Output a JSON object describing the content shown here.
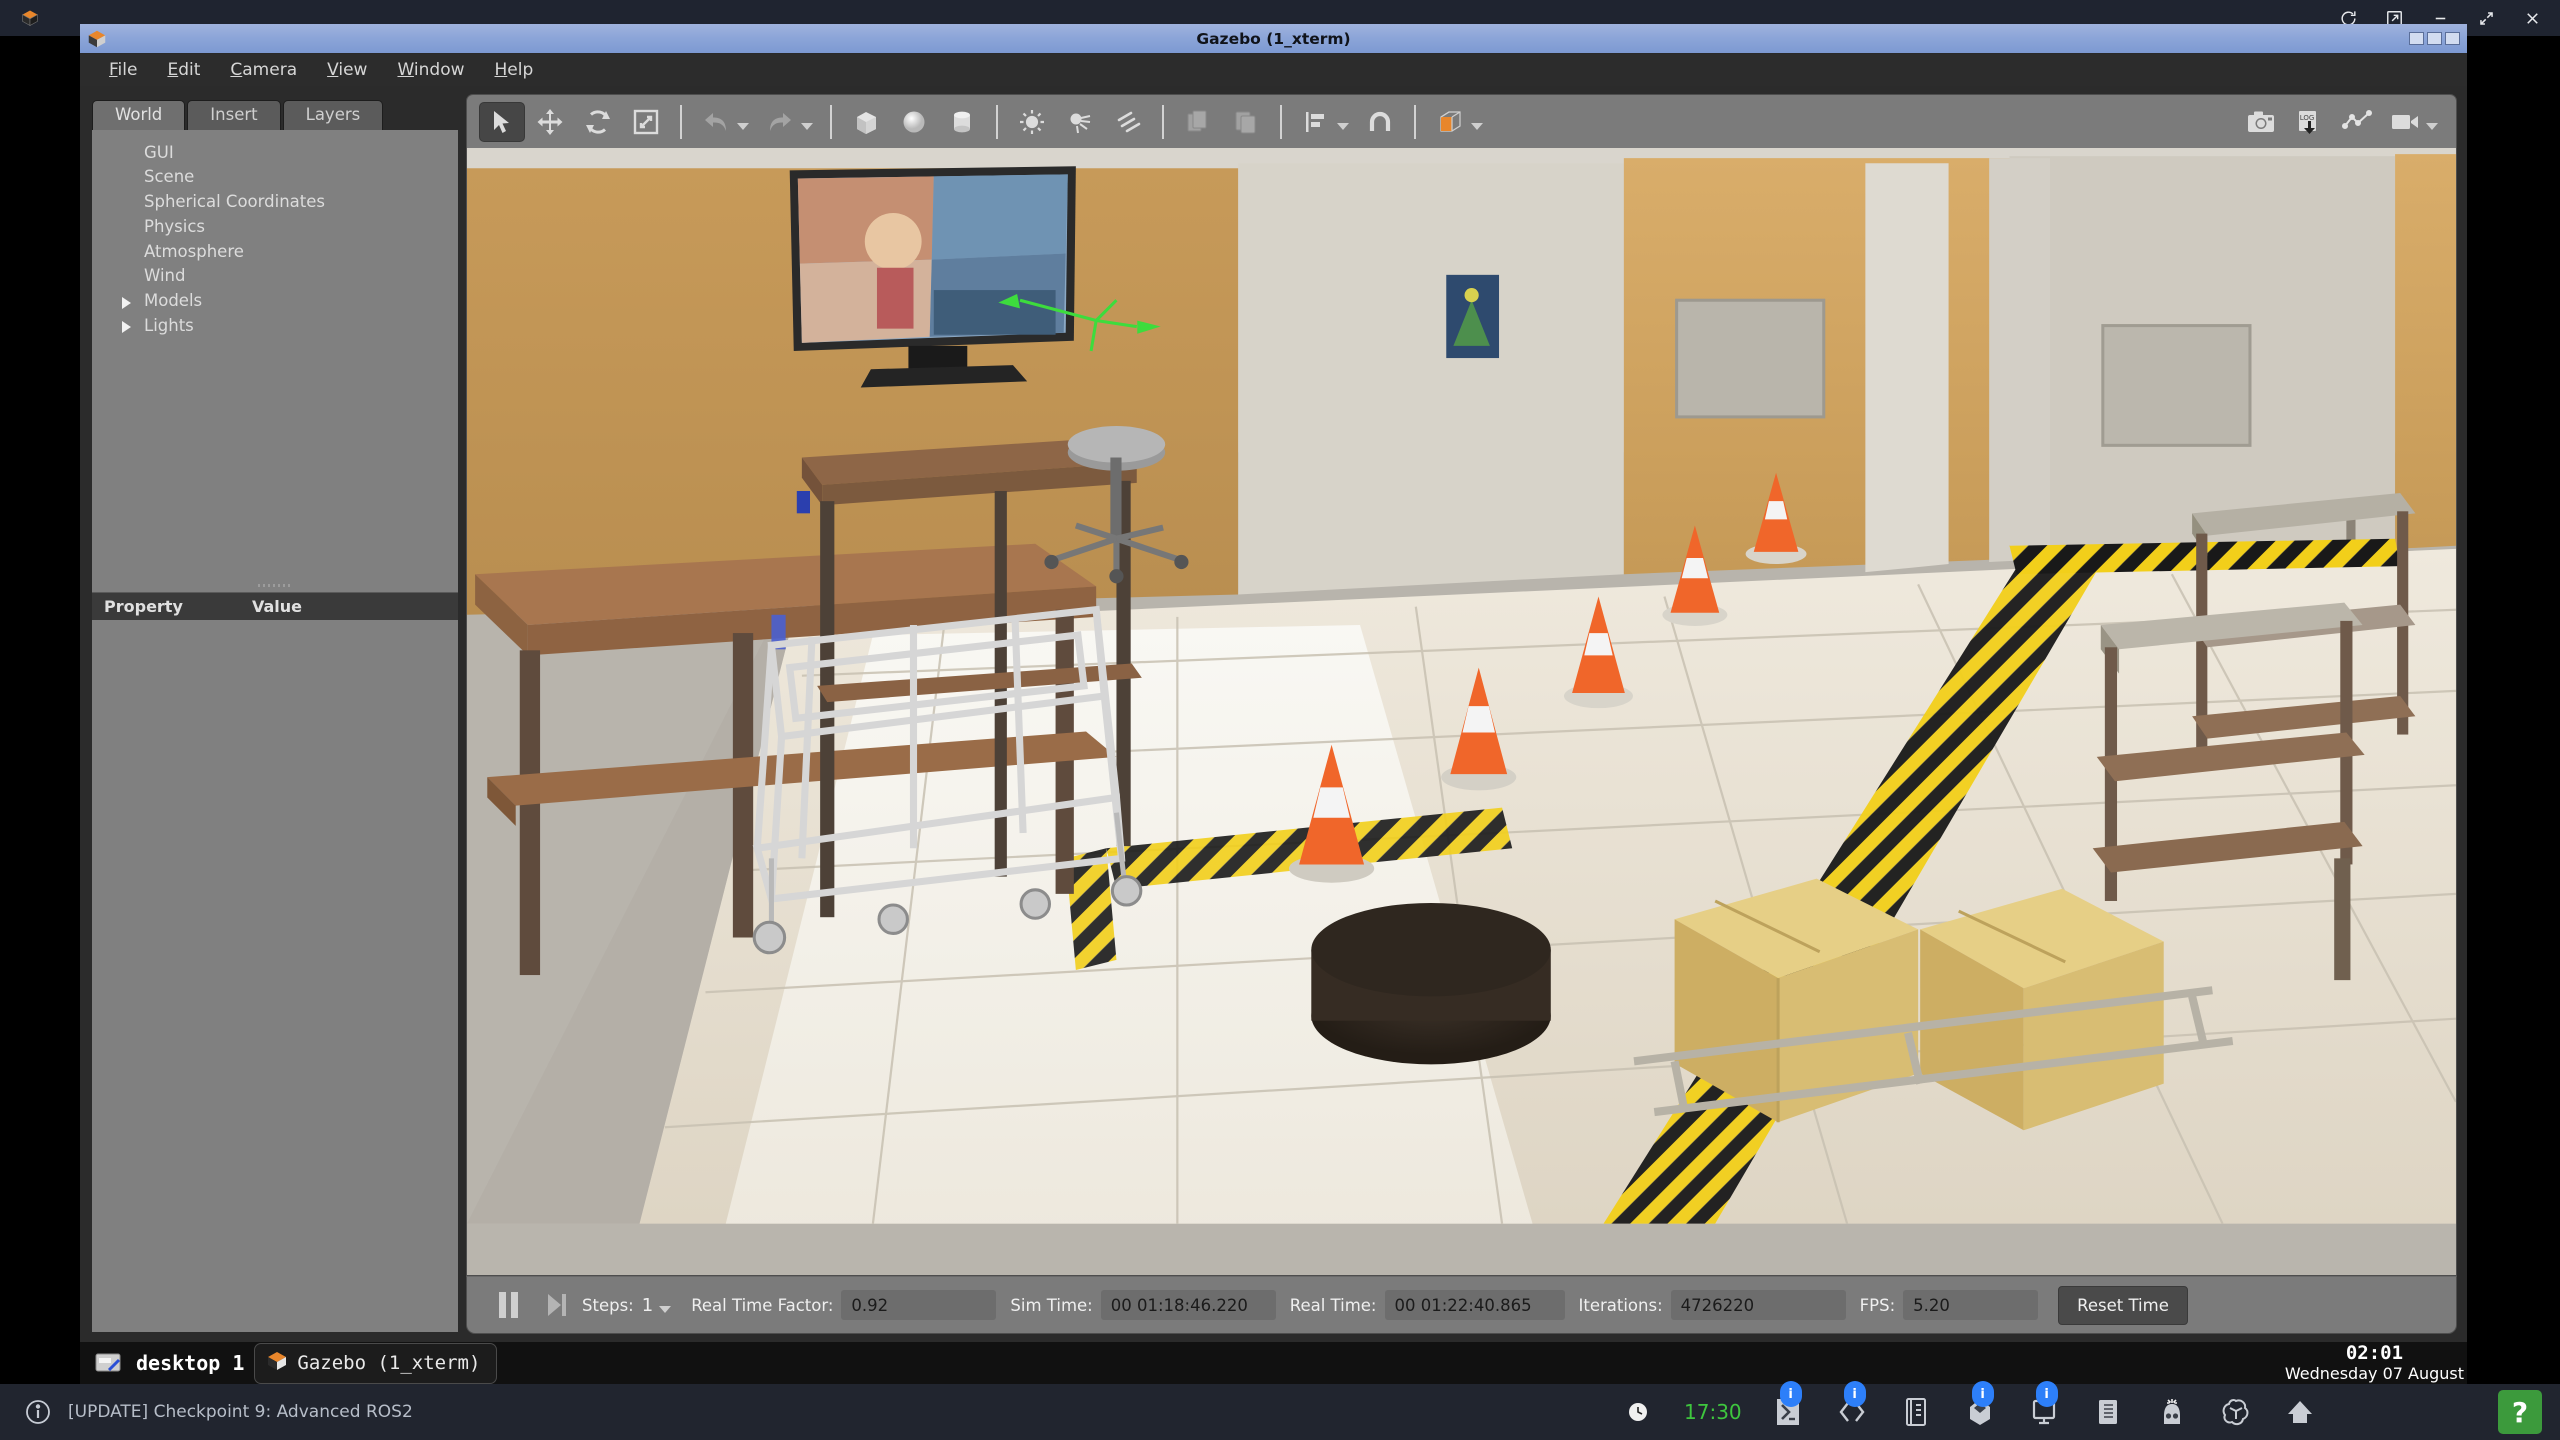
{
  "window": {
    "title": "Gazebo (1_xterm)",
    "icon": "gazebo-icon"
  },
  "top_chrome": {
    "app_icon": "gazebo-icon",
    "buttons": [
      {
        "name": "refresh-icon",
        "glyph": "⟳"
      },
      {
        "name": "external-link-icon",
        "glyph": "↗"
      },
      {
        "name": "minimize-icon",
        "glyph": "—"
      },
      {
        "name": "maximize-icon",
        "glyph": "⤡"
      },
      {
        "name": "close-icon",
        "glyph": "✕"
      }
    ]
  },
  "menubar": {
    "items": [
      {
        "label": "File",
        "mnemonic": "F"
      },
      {
        "label": "Edit",
        "mnemonic": "E"
      },
      {
        "label": "Camera",
        "mnemonic": "C"
      },
      {
        "label": "View",
        "mnemonic": "V"
      },
      {
        "label": "Window",
        "mnemonic": "W"
      },
      {
        "label": "Help",
        "mnemonic": "H"
      }
    ]
  },
  "left_panel": {
    "tabs": [
      {
        "label": "World",
        "active": true
      },
      {
        "label": "Insert",
        "active": false
      },
      {
        "label": "Layers",
        "active": false
      }
    ],
    "tree": [
      {
        "label": "GUI",
        "expandable": false
      },
      {
        "label": "Scene",
        "expandable": false
      },
      {
        "label": "Spherical Coordinates",
        "expandable": false
      },
      {
        "label": "Physics",
        "expandable": false
      },
      {
        "label": "Atmosphere",
        "expandable": false
      },
      {
        "label": "Wind",
        "expandable": false
      },
      {
        "label": "Models",
        "expandable": true
      },
      {
        "label": "Lights",
        "expandable": true
      }
    ],
    "property_table": {
      "columns": [
        "Property",
        "Value"
      ],
      "rows": []
    }
  },
  "toolbar": {
    "left_group": [
      {
        "name": "select-mode-icon",
        "active": true
      },
      {
        "name": "translate-mode-icon",
        "active": false
      },
      {
        "name": "rotate-mode-icon",
        "active": false
      },
      {
        "name": "scale-mode-icon",
        "active": false
      }
    ],
    "history_group": [
      {
        "name": "undo-icon",
        "disabled": true
      },
      {
        "name": "undo-dropdown-icon",
        "disabled": true
      },
      {
        "name": "redo-icon",
        "disabled": true
      },
      {
        "name": "redo-dropdown-icon",
        "disabled": true
      }
    ],
    "primitive_group": [
      {
        "name": "box-icon"
      },
      {
        "name": "sphere-icon"
      },
      {
        "name": "cylinder-icon"
      }
    ],
    "light_group": [
      {
        "name": "point-light-icon"
      },
      {
        "name": "spot-light-icon"
      },
      {
        "name": "directional-light-icon"
      }
    ],
    "clipboard_group": [
      {
        "name": "copy-icon",
        "disabled": true
      },
      {
        "name": "paste-icon",
        "disabled": true
      }
    ],
    "align_group": [
      {
        "name": "align-icon"
      },
      {
        "name": "snap-magnet-icon"
      }
    ],
    "view_group": [
      {
        "name": "view-angle-cube-icon",
        "accent": "#e8862b"
      }
    ],
    "right_group": [
      {
        "name": "screenshot-camera-icon"
      },
      {
        "name": "log-record-icon",
        "label": "LOG"
      },
      {
        "name": "plot-graph-icon"
      },
      {
        "name": "video-record-icon"
      }
    ]
  },
  "status_bar": {
    "pause_icon": "pause-icon",
    "step_icon": "step-forward-icon",
    "steps_label": "Steps:",
    "steps_value": "1",
    "real_time_factor_label": "Real Time Factor:",
    "real_time_factor_value": "0.92",
    "sim_time_label": "Sim Time:",
    "sim_time_value": "00 01:18:46.220",
    "real_time_label": "Real Time:",
    "real_time_value": "00 01:22:40.865",
    "iterations_label": "Iterations:",
    "iterations_value": "4726220",
    "fps_label": "FPS:",
    "fps_value": "5.20",
    "reset_button": "Reset Time"
  },
  "taskbar": {
    "desktop_icon": "desktop-icon",
    "desktop_label": "desktop 1",
    "task_icon": "gazebo-icon",
    "task_label": "Gazebo (1_xterm)",
    "clock_time": "02:01",
    "clock_date": "Wednesday 07 August"
  },
  "system_bar": {
    "info_icon": "info-icon",
    "notice": "[UPDATE] Checkpoint 9: Advanced ROS2",
    "clock_icon": "clock-icon",
    "clock_value": "17:30",
    "icons": [
      {
        "name": "terminal-icon",
        "badge": "i"
      },
      {
        "name": "code-editor-icon",
        "badge": "i"
      },
      {
        "name": "notebook-icon",
        "badge": ""
      },
      {
        "name": "gazebo-icon",
        "badge": "i"
      },
      {
        "name": "desktop-monitor-icon",
        "badge": "i"
      },
      {
        "name": "book-icon",
        "badge": ""
      },
      {
        "name": "robot-icon",
        "badge": ""
      },
      {
        "name": "openai-icon",
        "badge": ""
      },
      {
        "name": "home-icon",
        "badge": ""
      }
    ],
    "help_button": "?",
    "help_color": "#3c9a3c"
  },
  "scene": {
    "description": "Gazebo 3D simulation of an indoor warehouse/office room",
    "objects": [
      "television-on-stand",
      "desk-table",
      "office-stool",
      "shelving-rack",
      "traffic-cone",
      "traffic-cone",
      "traffic-cone",
      "traffic-cone",
      "traffic-cone",
      "cardboard-box",
      "cardboard-box",
      "floor-hole",
      "hazard-tape-line",
      "wall-poster",
      "metal-cart-frame",
      "selection-axis-marker"
    ],
    "colors": {
      "floor": "#e6ded0",
      "wall_osb": "#caa367",
      "hazard_yellow": "#f2cf1a",
      "cone_orange": "#f0662a",
      "cardboard": "#d9bb72"
    }
  }
}
